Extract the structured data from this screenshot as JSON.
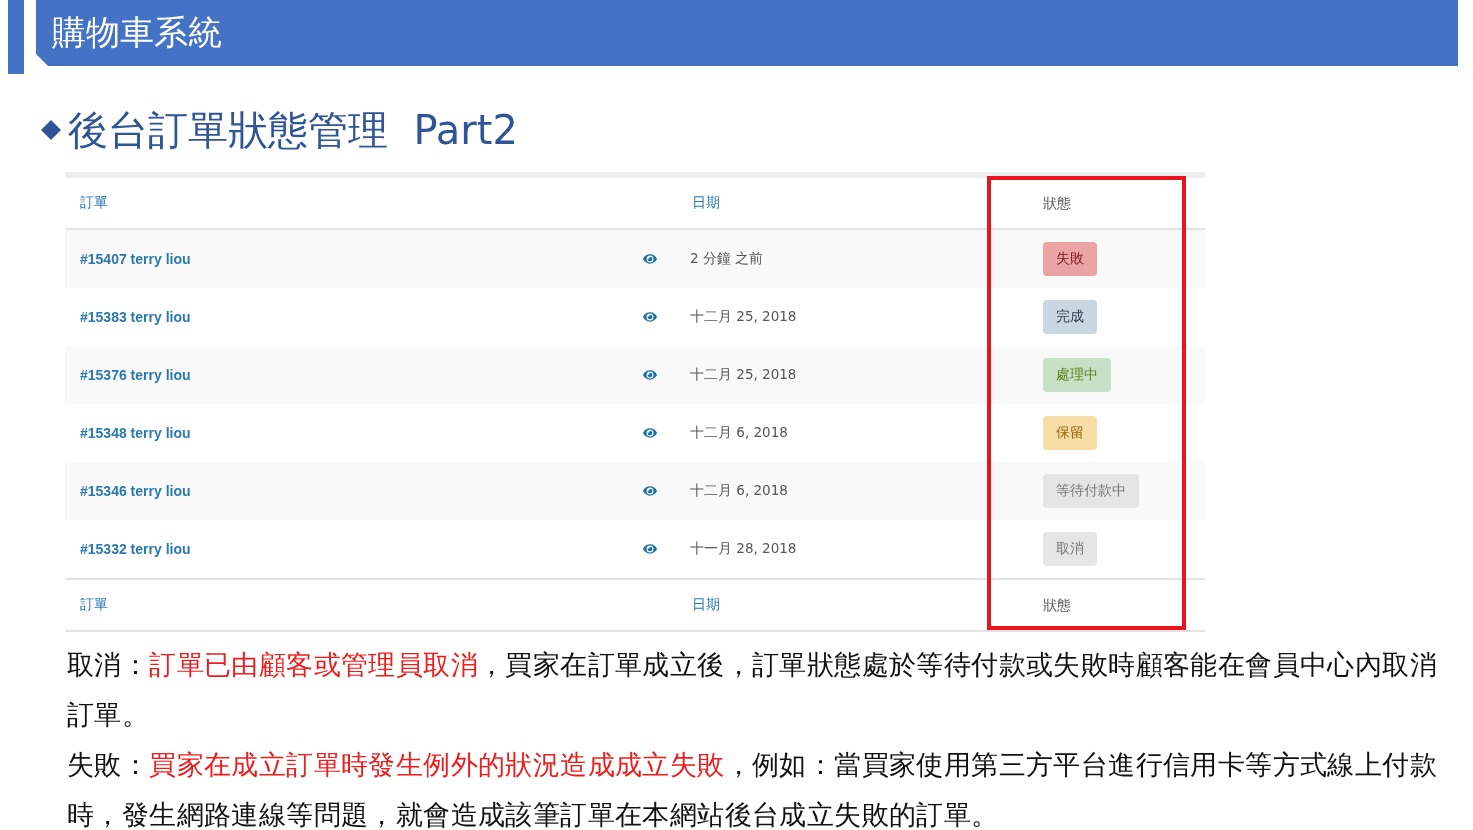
{
  "header": {
    "title": "購物車系統"
  },
  "heading": {
    "text": "後台訂單狀態管理  Part2"
  },
  "table": {
    "columns": [
      "訂單",
      "日期",
      "狀態"
    ],
    "rows": [
      {
        "order": "#15407 terry liou",
        "date": "2 分鐘 之前",
        "status": "失敗",
        "kind": "failed"
      },
      {
        "order": "#15383 terry liou",
        "date": "十二月 25, 2018",
        "status": "完成",
        "kind": "completed"
      },
      {
        "order": "#15376 terry liou",
        "date": "十二月 25, 2018",
        "status": "處理中",
        "kind": "processing"
      },
      {
        "order": "#15348 terry liou",
        "date": "十二月 6, 2018",
        "status": "保留",
        "kind": "onhold"
      },
      {
        "order": "#15346 terry liou",
        "date": "十二月 6, 2018",
        "status": "等待付款中",
        "kind": "pending"
      },
      {
        "order": "#15332 terry liou",
        "date": "十一月 28, 2018",
        "status": "取消",
        "kind": "cancelled"
      }
    ],
    "footer": [
      "訂單",
      "日期",
      "狀態"
    ]
  },
  "notes": [
    {
      "label": "取消：",
      "highlight": "訂單已由顧客或管理員取消",
      "rest": "，買家在訂單成立後，訂單狀態處於等待付款或失敗時顧客能在會員中心內取消訂單。"
    },
    {
      "label": "失敗：",
      "highlight": "買家在成立訂單時發生例外的狀況造成成立失敗",
      "rest": "，例如：當買家使用第三方平台進行信用卡等方式線上付款時，發生網路連線等問題，就會造成該筆訂單在本網站後台成立失敗的訂單。"
    }
  ]
}
